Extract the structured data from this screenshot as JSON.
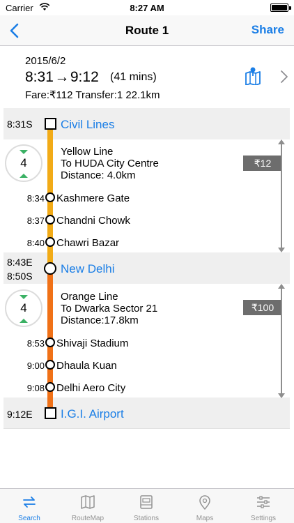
{
  "status_bar": {
    "carrier": "Carrier",
    "time": "8:27 AM"
  },
  "nav": {
    "title": "Route 1",
    "share_label": "Share"
  },
  "summary": {
    "date": "2015/6/2",
    "depart": "8:31",
    "arrow": "→",
    "arrive": "9:12",
    "duration": "(41 mins)",
    "fare_line": "Fare:₹112 Transfer:1 22.1km"
  },
  "colors": {
    "yellow_line": "#f2ab17",
    "orange_line": "#f07117",
    "accent": "#1a7ee6",
    "stop_count_arrows": "#3bb164"
  },
  "legs": [
    {
      "line": "Yellow Line",
      "direction": "To HUDA City Centre",
      "distance": "Distance: 4.0km",
      "stop_count": "4",
      "fare": "₹12",
      "stops": [
        {
          "time": "8:34",
          "name": "Kashmere Gate"
        },
        {
          "time": "8:37",
          "name": "Chandni Chowk"
        },
        {
          "time": "8:40",
          "name": "Chawri Bazar"
        }
      ]
    },
    {
      "line": "Orange Line",
      "direction": "To Dwarka Sector 21",
      "distance": "Distance:17.8km",
      "stop_count": "4",
      "fare": "₹100",
      "stops": [
        {
          "time": "8:53",
          "name": "Shivaji Stadium"
        },
        {
          "time": "9:00",
          "name": "Dhaula Kuan"
        },
        {
          "time": "9:08",
          "name": "Delhi Aero City"
        }
      ]
    }
  ],
  "stations": [
    {
      "name": "Civil Lines",
      "time": "8:31S"
    },
    {
      "name": "New Delhi",
      "arrive": "8:43E",
      "depart": "8:50S"
    },
    {
      "name": "I.G.I. Airport",
      "time": "9:12E"
    }
  ],
  "tabs": [
    {
      "label": "Search",
      "icon": "swap-arrows-icon",
      "active": true
    },
    {
      "label": "RouteMap",
      "icon": "map-icon",
      "active": false
    },
    {
      "label": "Stations",
      "icon": "station-icon",
      "active": false
    },
    {
      "label": "Maps",
      "icon": "location-pin-icon",
      "active": false
    },
    {
      "label": "Settings",
      "icon": "sliders-icon",
      "active": false
    }
  ]
}
